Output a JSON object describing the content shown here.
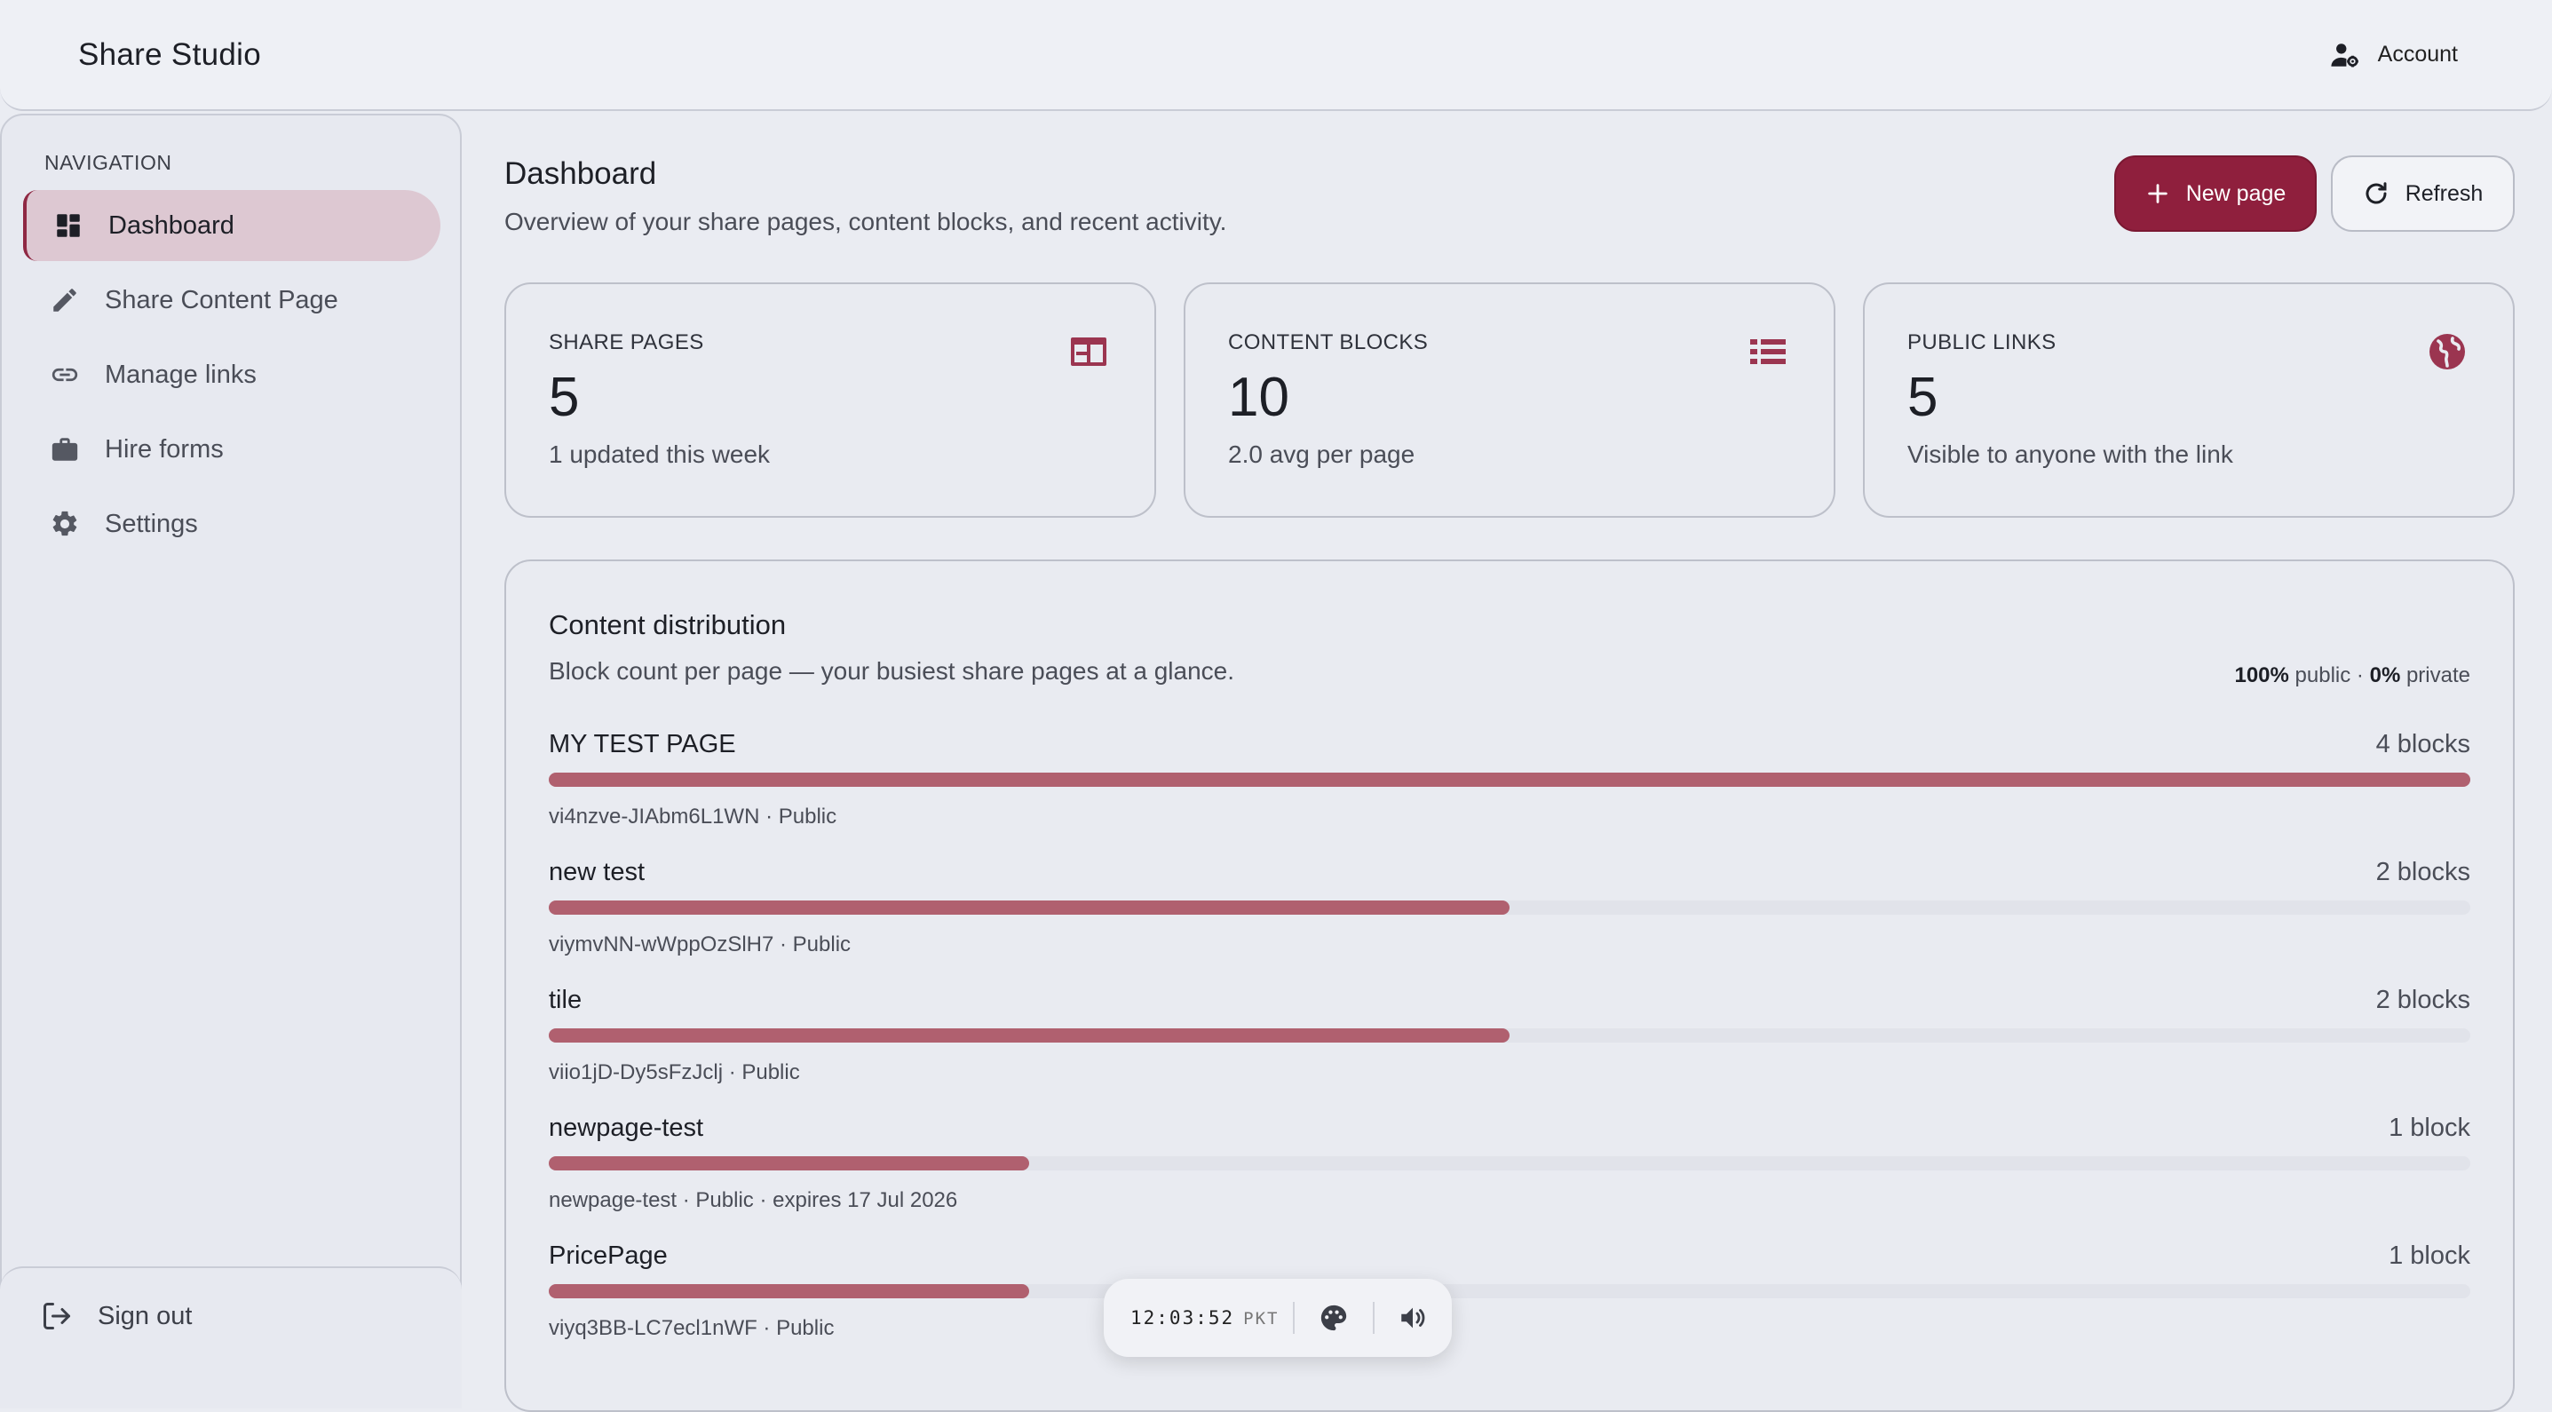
{
  "header": {
    "brand": "Share Studio",
    "account_label": "Account"
  },
  "sidebar": {
    "section_title": "NAVIGATION",
    "items": [
      {
        "label": "Dashboard",
        "icon": "dashboard-icon",
        "active": true
      },
      {
        "label": "Share Content Page",
        "icon": "pencil-icon"
      },
      {
        "label": "Manage links",
        "icon": "link-icon"
      },
      {
        "label": "Hire forms",
        "icon": "briefcase-icon"
      },
      {
        "label": "Settings",
        "icon": "gear-icon"
      }
    ],
    "signout_label": "Sign out"
  },
  "main": {
    "title": "Dashboard",
    "subtitle": "Overview of your share pages, content blocks, and recent activity.",
    "new_page_label": "New page",
    "refresh_label": "Refresh",
    "stats": [
      {
        "label": "SHARE PAGES",
        "value": "5",
        "note": "1 updated this week",
        "icon": "web-page-icon"
      },
      {
        "label": "CONTENT BLOCKS",
        "value": "10",
        "note": "2.0 avg per page",
        "icon": "list-icon"
      },
      {
        "label": "PUBLIC LINKS",
        "value": "5",
        "note": "Visible to anyone with the link",
        "icon": "globe-icon"
      }
    ],
    "distribution": {
      "title": "Content distribution",
      "subtitle": "Block count per page — your busiest share pages at a glance.",
      "public_pct": "100%",
      "public_word": "public",
      "separator": "·",
      "private_pct": "0%",
      "private_word": "private",
      "rows": [
        {
          "name": "MY TEST PAGE",
          "count": "4 blocks",
          "fraction": 1.0,
          "meta": "vi4nzve-JIAbm6L1WN · Public"
        },
        {
          "name": "new test",
          "count": "2 blocks",
          "fraction": 0.5,
          "meta": "viymvNN-wWppOzSlH7 · Public"
        },
        {
          "name": "tile",
          "count": "2 blocks",
          "fraction": 0.5,
          "meta": "viio1jD-Dy5sFzJclj · Public"
        },
        {
          "name": "newpage-test",
          "count": "1 block",
          "fraction": 0.25,
          "meta": "newpage-test · Public · expires 17 Jul 2026"
        },
        {
          "name": "PricePage",
          "count": "1 block",
          "fraction": 0.25,
          "meta": "viyq3BB-LC7ecl1nWF · Public"
        }
      ]
    }
  },
  "clock": {
    "time": "12:03:52",
    "tz": "PKT"
  },
  "colors": {
    "accent": "#8f1f3d",
    "bar_fill": "#b0606f",
    "icon_accent": "#9b3550"
  }
}
